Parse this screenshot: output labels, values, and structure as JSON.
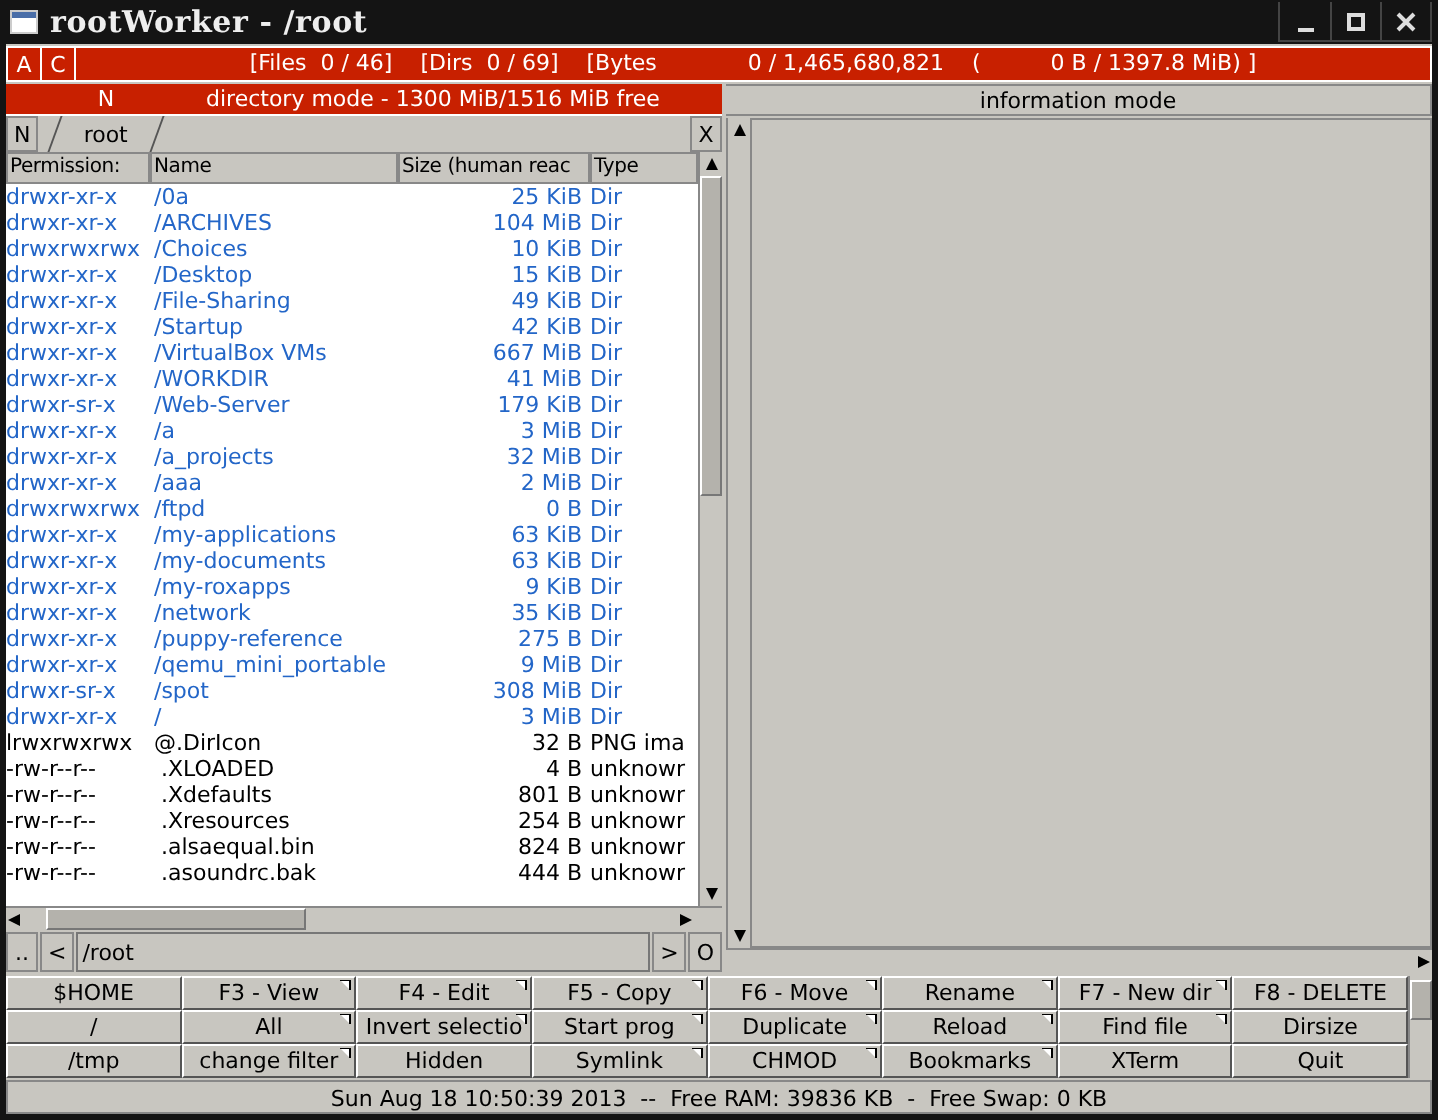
{
  "window": {
    "title": "rootWorker - /root"
  },
  "top_bar": {
    "buttons": [
      "A",
      "C"
    ],
    "summary": "[Files  0 / 46]    [Dirs  0 / 69]    [Bytes             0 / 1,465,680,821    (          0 B / 1397.8 MiB) ]"
  },
  "left_pane": {
    "mode_button": "N",
    "mode": "directory mode - 1300 MiB/1516 MiB free",
    "new_tab_button": "N",
    "tabs": [
      {
        "label": "root",
        "selected": true
      }
    ],
    "close_button": "X",
    "columns": [
      "Permission:",
      "Name",
      "Size (human reac",
      "Type"
    ],
    "rows": [
      {
        "kind": "dir",
        "perm": "drwxr-xr-x",
        "name": "/0a",
        "size": "25 KiB",
        "type": "Dir"
      },
      {
        "kind": "dir",
        "perm": "drwxr-xr-x",
        "name": "/ARCHIVES",
        "size": "104 MiB",
        "type": "Dir"
      },
      {
        "kind": "dir",
        "perm": "drwxrwxrwx",
        "name": "/Choices",
        "size": "10 KiB",
        "type": "Dir"
      },
      {
        "kind": "dir",
        "perm": "drwxr-xr-x",
        "name": "/Desktop",
        "size": "15 KiB",
        "type": "Dir"
      },
      {
        "kind": "dir",
        "perm": "drwxr-xr-x",
        "name": "/File-Sharing",
        "size": "49 KiB",
        "type": "Dir"
      },
      {
        "kind": "dir",
        "perm": "drwxr-xr-x",
        "name": "/Startup",
        "size": "42 KiB",
        "type": "Dir"
      },
      {
        "kind": "dir",
        "perm": "drwxr-xr-x",
        "name": "/VirtualBox VMs",
        "size": "667 MiB",
        "type": "Dir"
      },
      {
        "kind": "dir",
        "perm": "drwxr-xr-x",
        "name": "/WORKDIR",
        "size": "41 MiB",
        "type": "Dir"
      },
      {
        "kind": "dir",
        "perm": "drwxr-sr-x",
        "name": "/Web-Server",
        "size": "179 KiB",
        "type": "Dir"
      },
      {
        "kind": "dir",
        "perm": "drwxr-xr-x",
        "name": "/a",
        "size": "3 MiB",
        "type": "Dir"
      },
      {
        "kind": "dir",
        "perm": "drwxr-xr-x",
        "name": "/a_projects",
        "size": "32 MiB",
        "type": "Dir"
      },
      {
        "kind": "dir",
        "perm": "drwxr-xr-x",
        "name": "/aaa",
        "size": "2 MiB",
        "type": "Dir"
      },
      {
        "kind": "dir",
        "perm": "drwxrwxrwx",
        "name": "/ftpd",
        "size": "0 B",
        "type": "Dir"
      },
      {
        "kind": "dir",
        "perm": "drwxr-xr-x",
        "name": "/my-applications",
        "size": "63 KiB",
        "type": "Dir"
      },
      {
        "kind": "dir",
        "perm": "drwxr-xr-x",
        "name": "/my-documents",
        "size": "63 KiB",
        "type": "Dir"
      },
      {
        "kind": "dir",
        "perm": "drwxr-xr-x",
        "name": "/my-roxapps",
        "size": "9 KiB",
        "type": "Dir"
      },
      {
        "kind": "dir",
        "perm": "drwxr-xr-x",
        "name": "/network",
        "size": "35 KiB",
        "type": "Dir"
      },
      {
        "kind": "dir",
        "perm": "drwxr-xr-x",
        "name": "/puppy-reference",
        "size": "275 B",
        "type": "Dir"
      },
      {
        "kind": "dir",
        "perm": "drwxr-xr-x",
        "name": "/qemu_mini_portable",
        "size": "9 MiB",
        "type": "Dir"
      },
      {
        "kind": "dir",
        "perm": "drwxr-sr-x",
        "name": "/spot",
        "size": "308 MiB",
        "type": "Dir"
      },
      {
        "kind": "dir",
        "perm": "drwxr-xr-x",
        "name": "/",
        "size": "3 MiB",
        "type": "Dir"
      },
      {
        "kind": "file",
        "perm": "lrwxrwxrwx",
        "name": "@.DirIcon",
        "size": "32 B",
        "type": "PNG ima"
      },
      {
        "kind": "file",
        "perm": "-rw-r--r--",
        "name": " .XLOADED",
        "size": "4 B",
        "type": "unknowr"
      },
      {
        "kind": "file",
        "perm": "-rw-r--r--",
        "name": " .Xdefaults",
        "size": "801 B",
        "type": "unknowr"
      },
      {
        "kind": "file",
        "perm": "-rw-r--r--",
        "name": " .Xresources",
        "size": "254 B",
        "type": "unknowr"
      },
      {
        "kind": "file",
        "perm": "-rw-r--r--",
        "name": " .alsaequal.bin",
        "size": "824 B",
        "type": "unknowr"
      },
      {
        "kind": "file",
        "perm": "-rw-r--r--",
        "name": " .asoundrc.bak",
        "size": "444 B",
        "type": "unknowr"
      }
    ],
    "path_bar": {
      "parent_button": "..",
      "back_button": "<",
      "path": "/root",
      "forward_button": ">",
      "open_button": "O"
    }
  },
  "right_pane": {
    "mode": "information mode"
  },
  "buttons": [
    [
      {
        "label": "$HOME",
        "menu": false
      },
      {
        "label": "F3 - View",
        "menu": true
      },
      {
        "label": "F4 - Edit",
        "menu": true
      },
      {
        "label": "F5 - Copy",
        "menu": true
      },
      {
        "label": "F6 - Move",
        "menu": true
      },
      {
        "label": "Rename",
        "menu": true
      },
      {
        "label": "F7 - New dir",
        "menu": true
      },
      {
        "label": "F8 - DELETE",
        "menu": false
      }
    ],
    [
      {
        "label": "/",
        "menu": false
      },
      {
        "label": "All",
        "menu": true
      },
      {
        "label": "Invert selectio",
        "menu": true
      },
      {
        "label": "Start prog",
        "menu": true
      },
      {
        "label": "Duplicate",
        "menu": true
      },
      {
        "label": "Reload",
        "menu": true
      },
      {
        "label": "Find file",
        "menu": true
      },
      {
        "label": "Dirsize",
        "menu": false
      }
    ],
    [
      {
        "label": "/tmp",
        "menu": false
      },
      {
        "label": "change filter",
        "menu": true
      },
      {
        "label": "Hidden",
        "menu": false
      },
      {
        "label": "Symlink",
        "menu": true
      },
      {
        "label": "CHMOD",
        "menu": true
      },
      {
        "label": "Bookmarks",
        "menu": true
      },
      {
        "label": "XTerm",
        "menu": false
      },
      {
        "label": "Quit",
        "menu": false
      }
    ]
  ],
  "status_bar": "Sun Aug 18 10:50:39 2013  --  Free RAM: 39836 KB  -  Free Swap: 0 KB"
}
